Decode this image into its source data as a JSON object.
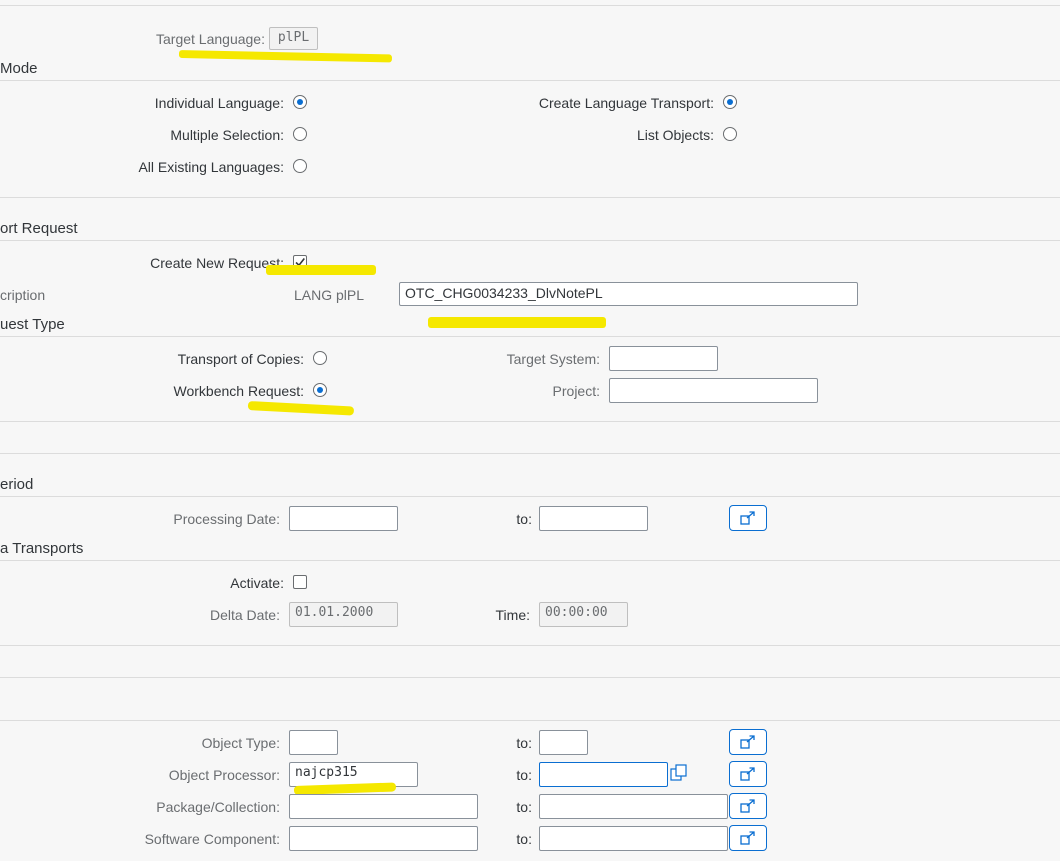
{
  "target_language": {
    "label": "Target Language:",
    "value": "plPL"
  },
  "mode": {
    "title": "Mode",
    "individual_language": {
      "label": "Individual Language:",
      "selected": true
    },
    "multiple_selection": {
      "label": "Multiple Selection:",
      "selected": false
    },
    "all_existing_languages": {
      "label": "All Existing Languages:",
      "selected": false
    },
    "create_language_transport": {
      "label": "Create Language Transport:",
      "selected": true
    },
    "list_objects": {
      "label": "List Objects:",
      "selected": false
    }
  },
  "transport_request": {
    "title": "ort Request",
    "create_new_request": {
      "label": "Create New Request:",
      "checked": true
    },
    "description": {
      "label": "cription",
      "prefix": "LANG plPL",
      "value": "OTC_CHG0034233_DlvNotePL"
    }
  },
  "request_type": {
    "title": "uest Type",
    "transport_of_copies": {
      "label": "Transport of Copies:",
      "selected": false
    },
    "workbench_request": {
      "label": "Workbench Request:",
      "selected": true
    },
    "target_system": {
      "label": "Target System:",
      "value": ""
    },
    "project": {
      "label": "Project:",
      "value": ""
    }
  },
  "period": {
    "title": "eriod",
    "processing_date": {
      "label": "Processing Date:",
      "from": "",
      "to_label": "to:",
      "to": ""
    }
  },
  "delta_transports": {
    "title": "a Transports",
    "activate": {
      "label": "Activate:",
      "checked": false
    },
    "delta_date": {
      "label": "Delta Date:",
      "value": "01.01.2000"
    },
    "time": {
      "label": "Time:",
      "value": "00:00:00"
    }
  },
  "objects": {
    "object_type": {
      "label": "Object Type:",
      "from": "",
      "to_label": "to:",
      "to": ""
    },
    "object_processor": {
      "label": "Object Processor:",
      "from": "najcp315",
      "to_label": "to:",
      "to": ""
    },
    "package_collection": {
      "label": "Package/Collection:",
      "from": "",
      "to_label": "to:",
      "to": ""
    },
    "software_component": {
      "label": "Software Component:",
      "from": "",
      "to_label": "to:",
      "to": ""
    }
  },
  "colors": {
    "accent": "#0a6ed1",
    "highlight": "#f5e800",
    "background": "#f7f7f7"
  },
  "icons": {
    "multiple_selection": "multiple-selection-icon",
    "value_help": "value-help-icon"
  }
}
